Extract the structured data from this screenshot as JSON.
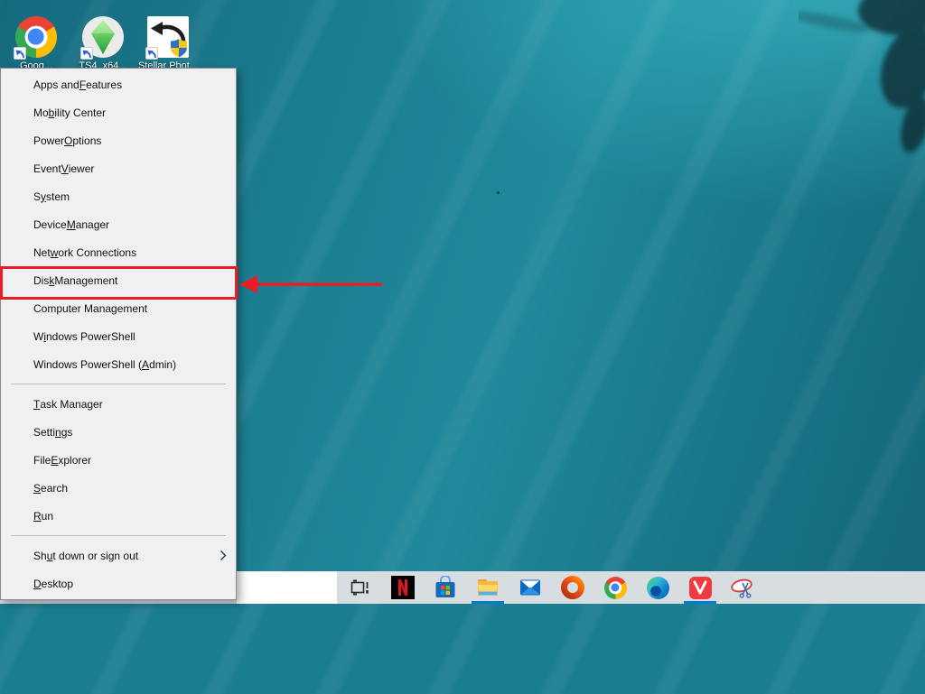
{
  "desktop": {
    "icons": [
      {
        "name": "google-chrome-shortcut",
        "label": "Goog..."
      },
      {
        "name": "ts4-x64-shortcut",
        "label": "TS4_x64..."
      },
      {
        "name": "stellar-photo-shortcut",
        "label": "Stellar Phot..."
      }
    ]
  },
  "winx_menu": {
    "items": [
      {
        "pre": "Apps and ",
        "accel": "F",
        "post": "eatures"
      },
      {
        "pre": "Mo",
        "accel": "b",
        "post": "ility Center"
      },
      {
        "pre": "Power ",
        "accel": "O",
        "post": "ptions"
      },
      {
        "pre": "Event ",
        "accel": "V",
        "post": "iewer"
      },
      {
        "pre": "S",
        "accel": "y",
        "post": "stem"
      },
      {
        "pre": "Device ",
        "accel": "M",
        "post": "anager"
      },
      {
        "pre": "Net",
        "accel": "w",
        "post": "ork Connections"
      },
      {
        "pre": "Dis",
        "accel": "k",
        "post": " Management"
      },
      {
        "pre": "Computer Mana",
        "accel": "g",
        "post": "ement"
      },
      {
        "pre": "W",
        "accel": "i",
        "post": "ndows PowerShell"
      },
      {
        "pre": "Windows PowerShell (",
        "accel": "A",
        "post": "dmin)"
      },
      {
        "pre": "",
        "accel": "T",
        "post": "ask Manager"
      },
      {
        "pre": "Setti",
        "accel": "n",
        "post": "gs"
      },
      {
        "pre": "File ",
        "accel": "E",
        "post": "xplorer"
      },
      {
        "pre": "",
        "accel": "S",
        "post": "earch"
      },
      {
        "pre": "",
        "accel": "R",
        "post": "un"
      },
      {
        "pre": "Sh",
        "accel": "u",
        "post": "t down or sign out"
      },
      {
        "pre": "",
        "accel": "D",
        "post": "esktop"
      }
    ]
  },
  "annotation": {
    "highlighted_item": "Disk Management",
    "shape": "red-box-with-left-pointing-arrow",
    "color": "#ec1c24"
  },
  "taskbar": {
    "icons": [
      {
        "name": "task-view-icon"
      },
      {
        "name": "netflix-icon"
      },
      {
        "name": "microsoft-store-icon"
      },
      {
        "name": "file-explorer-icon",
        "running": true
      },
      {
        "name": "mail-icon"
      },
      {
        "name": "office-icon"
      },
      {
        "name": "chrome-icon"
      },
      {
        "name": "edge-icon"
      },
      {
        "name": "vivaldi-icon",
        "running": true
      },
      {
        "name": "snipping-tool-icon"
      }
    ]
  },
  "colors": {
    "annotation_red": "#ec1c24",
    "taskbar_bg": "#d8dde2",
    "running_underline": "#0b79d0",
    "menu_bg": "#eef0f1",
    "wallpaper_teal": "#1b7d90"
  }
}
